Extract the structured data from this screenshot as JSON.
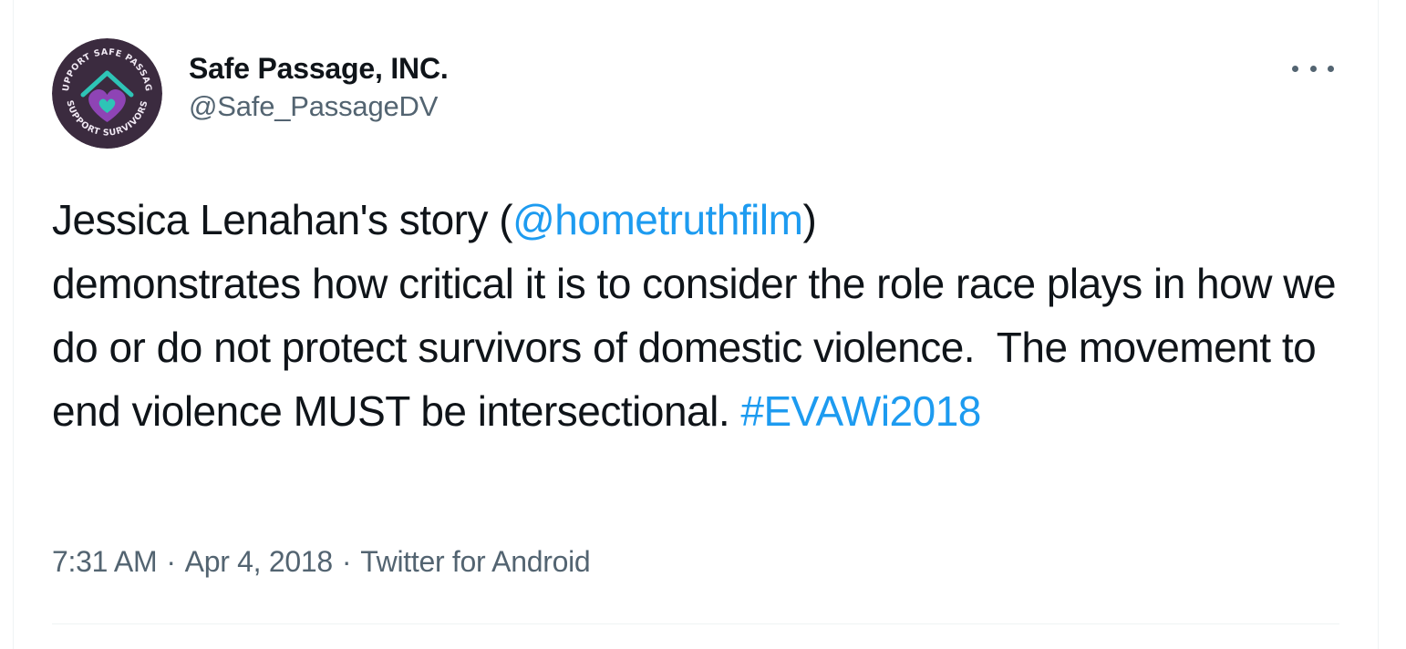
{
  "tweet": {
    "author": {
      "display_name": "Safe Passage, INC.",
      "handle": "@Safe_PassageDV",
      "avatar_icon": "safe-passage-logo",
      "avatar_ring_text_top": "SUPPORT SAFE PASSAGE",
      "avatar_ring_text_bottom": "SUPPORT SURVIVORS"
    },
    "more_icon": "more-horizontal-icon",
    "text": {
      "line1_before": "Jessica Lenahan's story (",
      "mention": "@hometruthfilm",
      "line1_after": ")",
      "body": "demonstrates how critical it is to consider the role race plays in how we do or do not protect survivors of domestic violence.  The movement to end violence MUST be intersectional. ",
      "hashtag": "#EVAWi2018"
    },
    "meta": {
      "time": "7:31 AM",
      "separator": "·",
      "date": "Apr 4, 2018",
      "source": "Twitter for Android"
    },
    "colors": {
      "link": "#1d9bf0",
      "text": "#0f1419",
      "secondary": "#536471",
      "avatar_bg": "#3b2b3f",
      "heart": "#8e44b5",
      "accent_teal": "#2ec4b6"
    }
  }
}
